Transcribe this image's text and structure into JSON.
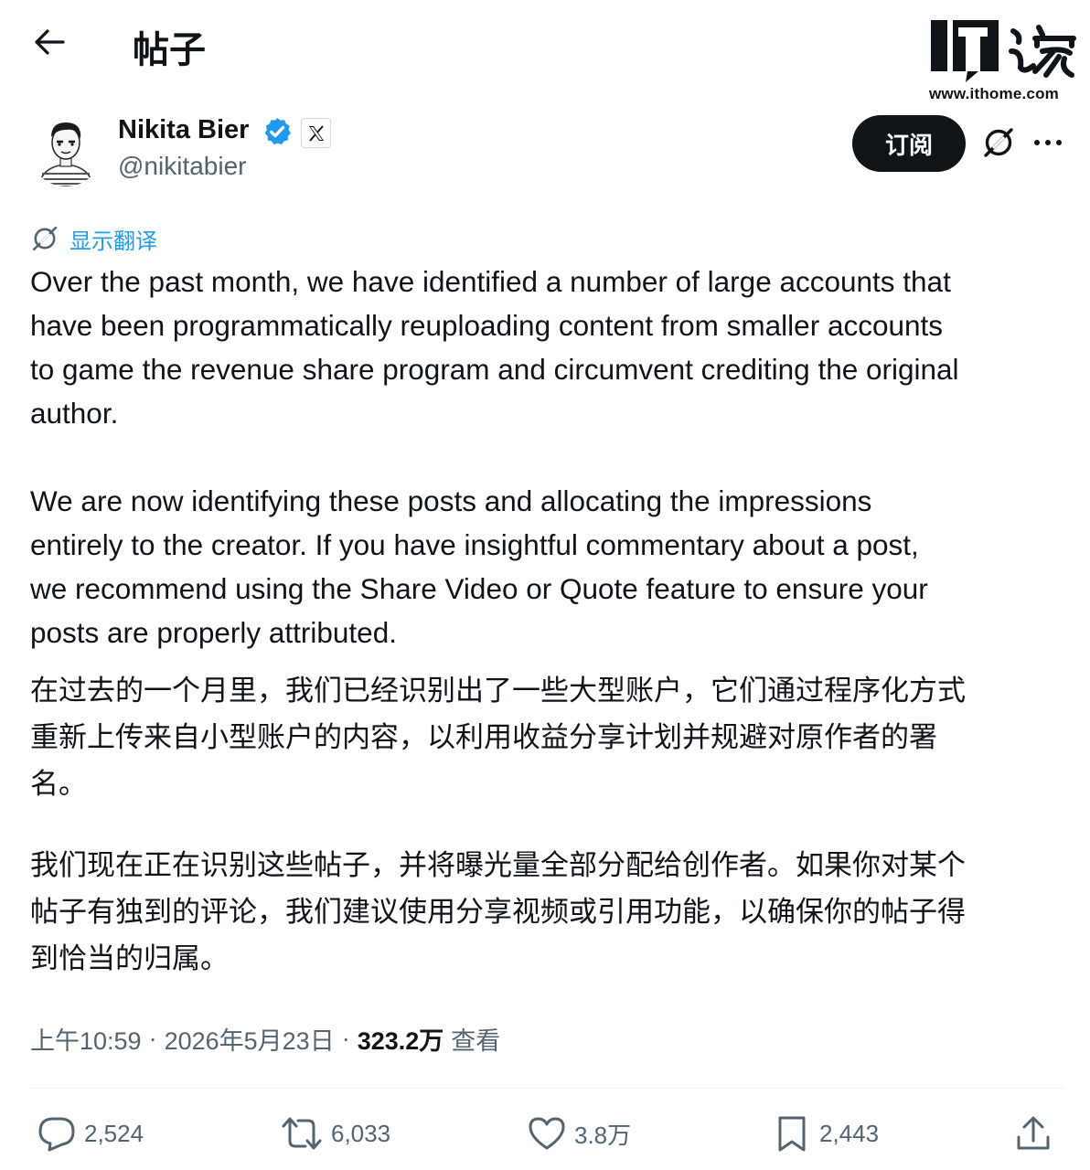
{
  "header": {
    "title": "帖子"
  },
  "watermark": {
    "logo_text": "IT之家",
    "url": "www.ithome.com"
  },
  "author": {
    "name": "Nikita Bier",
    "handle": "@nikitabier"
  },
  "actions_top": {
    "subscribe_label": "订阅"
  },
  "translate": {
    "label": "显示翻译"
  },
  "post": {
    "paragraph_1": "Over the past month, we have identified a number of large accounts that\nhave been programmatically reuploading content from smaller accounts\nto game the revenue share program and circumvent crediting the original\nauthor.",
    "paragraph_2": "We are now identifying these posts and allocating the impressions\nentirely to the creator. If you have insightful commentary about a post,\nwe recommend using the Share Video or Quote feature to ensure your\nposts are properly attributed.",
    "zh_paragraph_1": "在过去的一个月里，我们已经识别出了一些大型账户，它们通过程序化方式\n重新上传来自小型账户的内容，以利用收益分享计划并规避对原作者的署\n名。",
    "zh_paragraph_2": "我们现在正在识别这些帖子，并将曝光量全部分配给创作者。如果你对某个\n帖子有独到的评论，我们建议使用分享视频或引用功能，以确保你的帖子得\n到恰当的归属。"
  },
  "meta": {
    "time": "上午10:59",
    "separator": "·",
    "date": "2026年5月23日",
    "views_count": "323.2万",
    "views_label": "查看"
  },
  "stats": {
    "replies": "2,524",
    "reposts": "6,033",
    "likes": "3.8万",
    "bookmarks": "2,443"
  },
  "colors": {
    "accent": "#1d9bf0",
    "text": "#0f1419",
    "muted": "#536471",
    "button_bg": "#0f1419"
  },
  "icons": [
    "back-arrow-icon",
    "verified-badge-icon",
    "x-logo-icon",
    "grok-icon",
    "more-icon",
    "reply-icon",
    "repost-icon",
    "like-icon",
    "bookmark-icon",
    "share-icon"
  ]
}
